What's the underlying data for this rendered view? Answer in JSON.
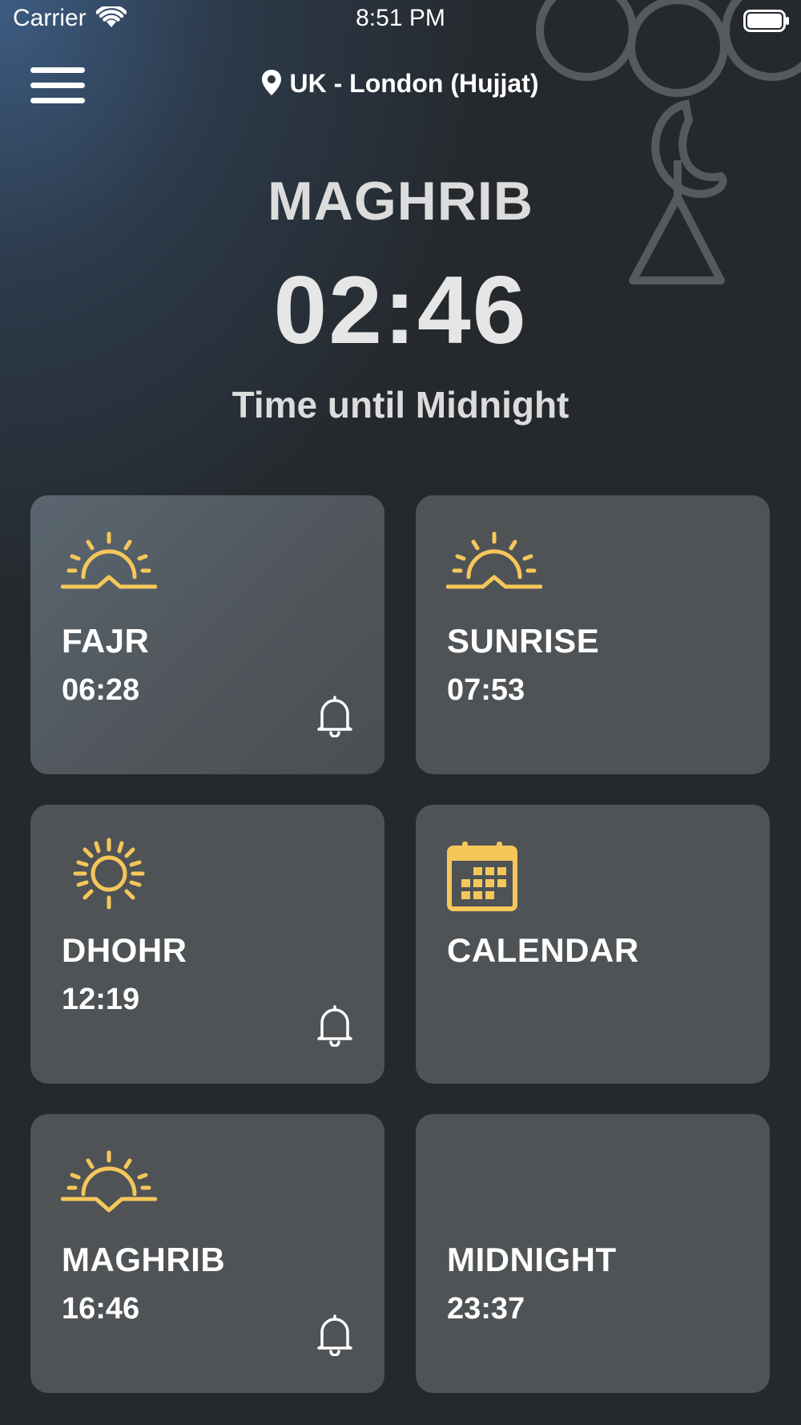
{
  "status_bar": {
    "carrier": "Carrier",
    "time": "8:51 PM"
  },
  "header": {
    "menu_icon": "hamburger-menu-icon",
    "location_icon": "map-pin-icon",
    "location": "UK - London (Hujjat)"
  },
  "next_prayer": {
    "name": "MAGHRIB",
    "countdown": "02:46",
    "subtitle": "Time until Midnight"
  },
  "colors": {
    "background": "#25292d",
    "card": "#4f5356",
    "accent": "#f5c75a",
    "text": "#ffffff"
  },
  "cards": [
    {
      "title": "FAJR",
      "time": "06:28",
      "icon": "sunrise-icon",
      "bell": true
    },
    {
      "title": "SUNRISE",
      "time": "07:53",
      "icon": "sunrise-icon",
      "bell": false
    },
    {
      "title": "DHOHR",
      "time": "12:19",
      "icon": "sun-icon",
      "bell": true
    },
    {
      "title": "CALENDAR",
      "time": "",
      "icon": "calendar-icon",
      "bell": false
    },
    {
      "title": "MAGHRIB",
      "time": "16:46",
      "icon": "sunset-icon",
      "bell": true
    },
    {
      "title": "MIDNIGHT",
      "time": "23:37",
      "icon": "moon-icon",
      "bell": false
    }
  ]
}
